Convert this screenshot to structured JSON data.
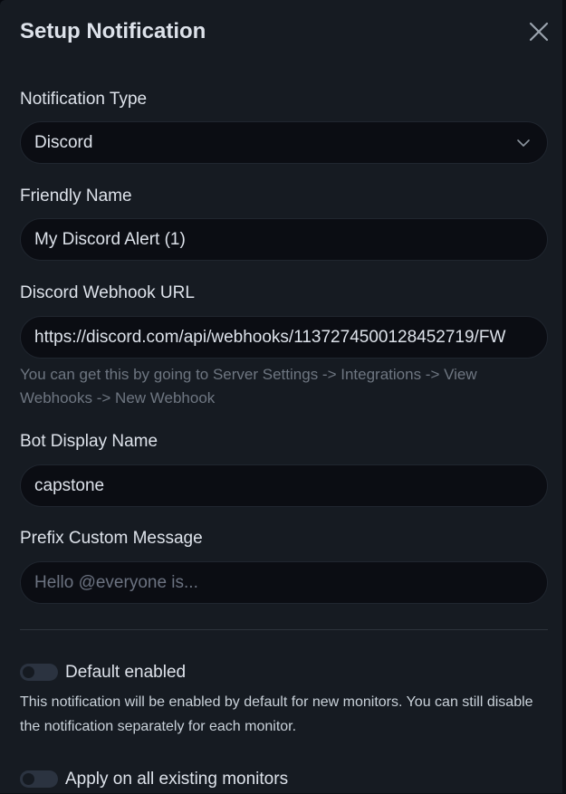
{
  "dialog": {
    "title": "Setup Notification",
    "close_icon": "close-icon"
  },
  "form": {
    "notification_type": {
      "label": "Notification Type",
      "value": "Discord",
      "icon": "chevron-down-icon"
    },
    "friendly_name": {
      "label": "Friendly Name",
      "value": "My Discord Alert (1)"
    },
    "webhook_url": {
      "label": "Discord Webhook URL",
      "value": "https://discord.com/api/webhooks/1137274500128452719/FW",
      "help": "You can get this by going to Server Settings -> Integrations -> View Webhooks -> New Webhook"
    },
    "bot_display_name": {
      "label": "Bot Display Name",
      "value": "capstone"
    },
    "prefix_message": {
      "label": "Prefix Custom Message",
      "value": "",
      "placeholder": "Hello @everyone is..."
    }
  },
  "toggles": {
    "default_enabled": {
      "label": "Default enabled",
      "enabled": false,
      "description": "This notification will be enabled by default for new monitors. You can still disable the notification separately for each monitor."
    },
    "apply_existing": {
      "label": "Apply on all existing monitors",
      "enabled": false
    }
  },
  "colors": {
    "background": "#161b22",
    "input_background": "#0b0d13",
    "text": "#dde2ea",
    "muted_text": "#6e7681",
    "toggle_off": "#2b3340"
  }
}
